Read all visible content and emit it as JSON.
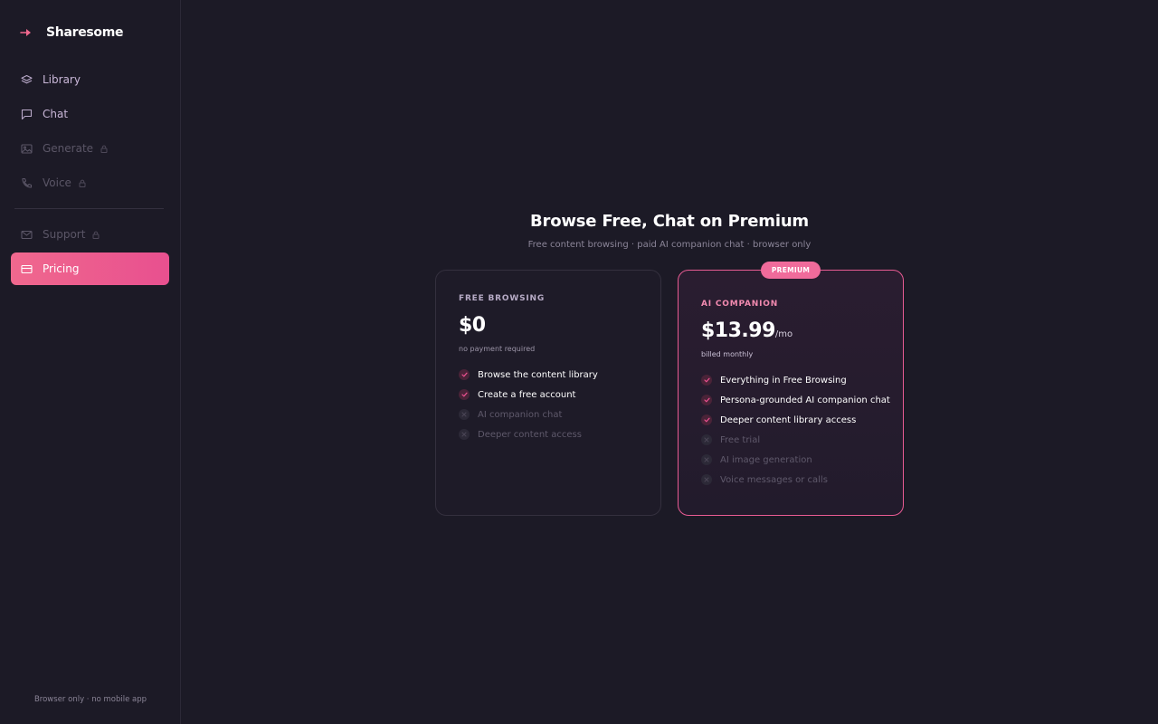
{
  "sidebar": {
    "brand": "Sharesome",
    "items": [
      {
        "label": "Library",
        "icon": "layers-icon",
        "state": "available"
      },
      {
        "label": "Chat",
        "icon": "chat-icon",
        "state": "available"
      },
      {
        "label": "Generate",
        "icon": "image-icon",
        "state": "locked"
      },
      {
        "label": "Voice",
        "icon": "phone-icon",
        "state": "locked"
      },
      {
        "label": "Support",
        "icon": "mail-icon",
        "state": "locked"
      },
      {
        "label": "Pricing",
        "icon": "card-icon",
        "state": "selected"
      }
    ],
    "footer": "Browser only · no mobile app"
  },
  "main": {
    "title": "Browse Free, Chat on Premium",
    "subtitle": "Free content browsing · paid AI companion chat · browser only"
  },
  "plans": [
    {
      "name": "FREE BROWSING",
      "price": "$0",
      "unit": "",
      "note": "no payment required",
      "features": [
        {
          "text": "Browse the content library",
          "included": true
        },
        {
          "text": "Create a free account",
          "included": true
        },
        {
          "text": "AI companion chat",
          "included": false
        },
        {
          "text": "Deeper content access",
          "included": false
        }
      ]
    },
    {
      "badge": "PREMIUM",
      "name": "AI COMPANION",
      "price": "$13.99",
      "unit": "/mo",
      "note": "billed monthly",
      "features": [
        {
          "text": "Everything in Free Browsing",
          "included": true
        },
        {
          "text": "Persona-grounded AI companion chat",
          "included": true
        },
        {
          "text": "Deeper content library access",
          "included": true
        },
        {
          "text": "Free trial",
          "included": false
        },
        {
          "text": "AI image generation",
          "included": false
        },
        {
          "text": "Voice messages or calls",
          "included": false
        }
      ]
    }
  ],
  "colors": {
    "background": "#1c1a26",
    "accent": "#f0688e",
    "accent_border": "#e85b93",
    "muted_text": "#8b8598"
  }
}
